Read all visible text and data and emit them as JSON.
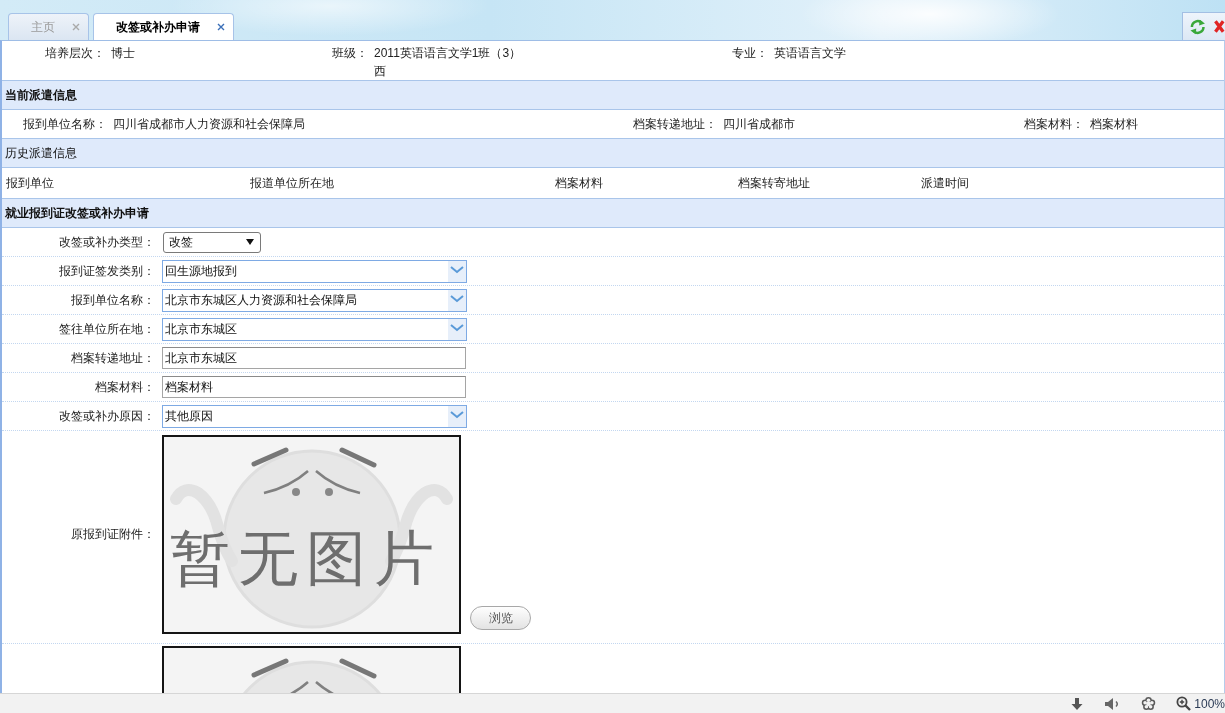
{
  "tabs": [
    {
      "label": "主页",
      "selected": false
    },
    {
      "label": "改签或补办申请",
      "selected": true
    }
  ],
  "student_info": [
    {
      "label": "培养层次：",
      "value": "博士"
    },
    {
      "label": "班级：",
      "value": "2011英语语言文学1班（3）西"
    },
    {
      "label": "专业：",
      "value": "英语语言文学"
    }
  ],
  "current_dispatch": {
    "title": "当前派遣信息",
    "bold": true,
    "fields": [
      {
        "label": "报到单位名称：",
        "value": "四川省成都市人力资源和社会保障局"
      },
      {
        "label": "档案转递地址：",
        "value": "四川省成都市"
      },
      {
        "label": "档案材料：",
        "value": "档案材料"
      }
    ]
  },
  "dispatch_history": {
    "title": "历史派遣信息",
    "bold": false,
    "columns": [
      "报到单位",
      "报道单位所在地",
      "档案材料",
      "档案转寄地址",
      "派遣时间"
    ]
  },
  "application": {
    "title": "就业报到证改签或补办申请",
    "bold": true,
    "fields": [
      {
        "kind": "select",
        "label": "改签或补办类型：",
        "value": "改签"
      },
      {
        "kind": "combo",
        "label": "报到证签发类别：",
        "value": "回生源地报到"
      },
      {
        "kind": "combo",
        "label": "报到单位名称：",
        "value": "北京市东城区人力资源和社会保障局"
      },
      {
        "kind": "combo",
        "label": "签往单位所在地：",
        "value": "北京市东城区"
      },
      {
        "kind": "text",
        "label": "档案转递地址：",
        "value": "北京市东城区"
      },
      {
        "kind": "text",
        "label": "档案材料：",
        "value": "档案材料"
      },
      {
        "kind": "combo",
        "label": "改签或补办原因：",
        "value": "其他原因"
      },
      {
        "kind": "attachment",
        "label": "原报到证附件：",
        "image_text": "暂无图片",
        "button": "浏览"
      },
      {
        "kind": "attachment"
      }
    ]
  },
  "status_bar": {
    "zoom": "100%"
  }
}
